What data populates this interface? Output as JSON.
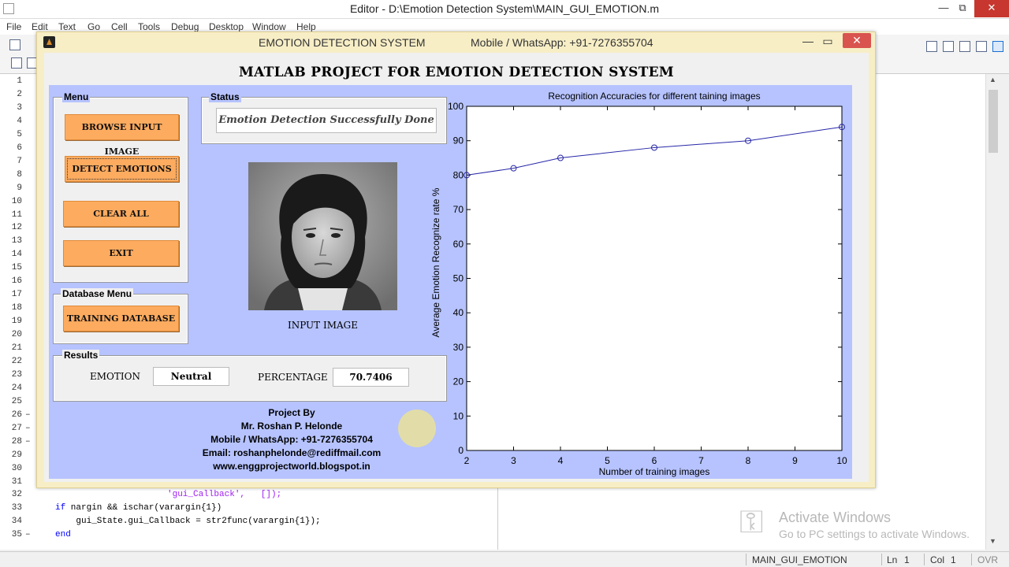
{
  "editor": {
    "title": "Editor - D:\\Emotion Detection System\\MAIN_GUI_EMOTION.m",
    "window_controls": {
      "minimize": "—",
      "maximize": "⧉",
      "close": "✕"
    },
    "menu": [
      "File",
      "Edit",
      "Text",
      "Go",
      "Cell",
      "Tools",
      "Debug",
      "Desktop",
      "Window",
      "Help"
    ],
    "line_numbers": [
      "1",
      "2",
      "3",
      "4",
      "5",
      "6",
      "7",
      "8",
      "9",
      "10",
      "11",
      "12",
      "13",
      "14",
      "15",
      "16",
      "17",
      "18",
      "19",
      "20",
      "21",
      "22",
      "23",
      "24",
      "25",
      "26",
      "27",
      "28",
      "29",
      "30",
      "31",
      "32",
      "33",
      "34",
      "35"
    ],
    "fold_marks": [
      "–",
      "–",
      "–",
      "–"
    ],
    "code_lines": [
      {
        "text": "'gui_Callback',   []);",
        "kind": "str"
      },
      {
        "kw": "if",
        "text": " nargin && ischar(varargin{1})"
      },
      {
        "text": "    gui_State.gui_Callback = str2func(varargin{1});"
      },
      {
        "kw": "end",
        "text": ""
      }
    ],
    "status": {
      "file": "MAIN_GUI_EMOTION",
      "ln_label": "Ln",
      "ln": "1",
      "col_label": "Col",
      "col": "1",
      "mode": "OVR"
    }
  },
  "watermark": {
    "title": "Activate Windows",
    "subtitle": "Go to PC settings to activate Windows."
  },
  "figure": {
    "title": "EMOTION DETECTION SYSTEM",
    "contact": "Mobile / WhatsApp: +91-7276355704",
    "controls": {
      "minimize": "—",
      "maximize": "▭",
      "close": "✕"
    },
    "heading": "MATLAB PROJECT FOR EMOTION DETECTION SYSTEM",
    "menu_panel": {
      "title": "Menu",
      "buttons": {
        "browse": "BROWSE INPUT IMAGE",
        "detect": "DETECT EMOTIONS",
        "clear": "CLEAR ALL",
        "exit": "EXIT"
      }
    },
    "database_panel": {
      "title": "Database Menu",
      "button": "TRAINING DATABASE"
    },
    "status_panel": {
      "title": "Status",
      "message": "Emotion Detection Successfully Done"
    },
    "image_label": "INPUT IMAGE",
    "results_panel": {
      "title": "Results",
      "emotion_label": "EMOTION",
      "emotion_value": "Neutral",
      "percentage_label": "PERCENTAGE",
      "percentage_value": "70.7406"
    },
    "credits": [
      "Project By",
      "Mr. Roshan P. Helonde",
      "Mobile / WhatsApp: +91-7276355704",
      "Email: roshanphelonde@rediffmail.com",
      "www.enggprojectworld.blogspot.in"
    ]
  },
  "chart_data": {
    "type": "line",
    "title": "Recognition Accuracies for different taining images",
    "xlabel": "Number of training images",
    "ylabel": "Average Emotion Recognize rate %",
    "x": [
      2,
      3,
      4,
      6,
      8,
      10
    ],
    "series": [
      {
        "values": [
          80,
          82,
          85,
          88,
          90,
          94
        ],
        "color": "#2626a8",
        "marker": "circle"
      }
    ],
    "xlim": [
      2,
      10
    ],
    "ylim": [
      0,
      100
    ],
    "xticks": [
      2,
      3,
      4,
      5,
      6,
      7,
      8,
      9,
      10
    ],
    "yticks": [
      0,
      10,
      20,
      30,
      40,
      50,
      60,
      70,
      80,
      90,
      100
    ],
    "grid": false
  }
}
